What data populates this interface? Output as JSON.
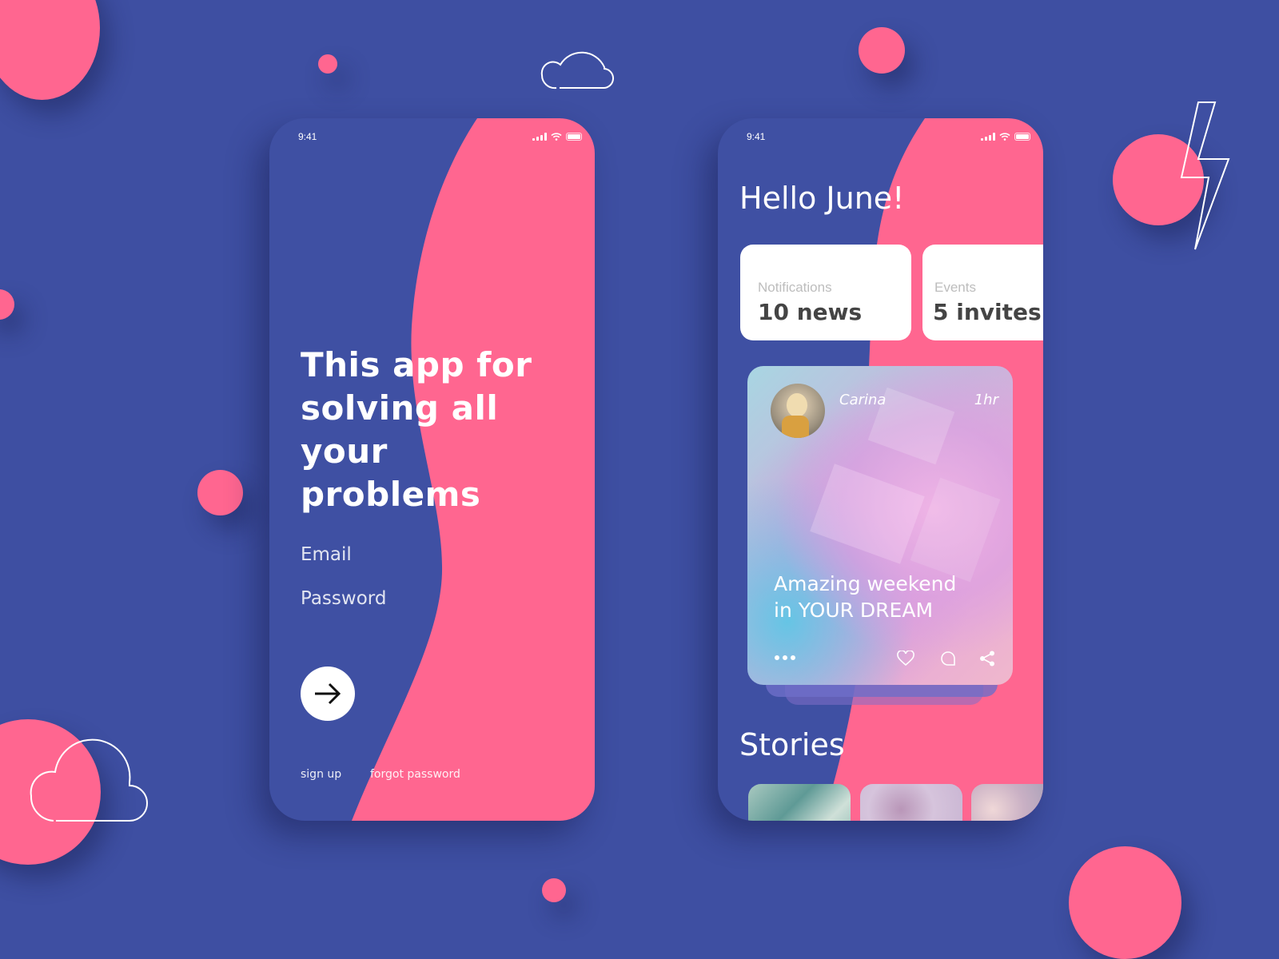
{
  "colors": {
    "background": "#3e4fa2",
    "accent_pink": "#ff6690",
    "card_white": "#ffffff",
    "tile_label": "#bdbdbd",
    "tile_value": "#444444"
  },
  "login_screen": {
    "status_bar": {
      "time": "9:41",
      "icons": [
        "signal-icon",
        "wifi-icon",
        "battery-icon"
      ]
    },
    "headline": "This app for solving all your problems",
    "email_label": "Email",
    "password_label": "Password",
    "submit_icon": "arrow-right-icon",
    "sign_up_link": "sign up",
    "forgot_password_link": "forgot password"
  },
  "home_screen": {
    "status_bar": {
      "time": "9:41",
      "icons": [
        "signal-icon",
        "wifi-icon",
        "battery-icon"
      ]
    },
    "greeting": "Hello June!",
    "tiles": [
      {
        "label": "Notifications",
        "value": "10 news"
      },
      {
        "label": "Events",
        "value": "5 invites"
      }
    ],
    "post_card": {
      "author": "Carina",
      "time_ago": "1hr",
      "caption_line1": "Amazing weekend",
      "caption_line2": "in YOUR DREAM",
      "actions": [
        "more-icon",
        "heart-icon",
        "comment-icon",
        "share-icon"
      ]
    },
    "stories_title": "Stories",
    "stories": [
      {
        "name": "story-1"
      },
      {
        "name": "story-2"
      },
      {
        "name": "story-3"
      }
    ]
  },
  "decorations": [
    "cloud-outline-icon",
    "lightning-outline-icon",
    "cloud-outline-icon"
  ]
}
